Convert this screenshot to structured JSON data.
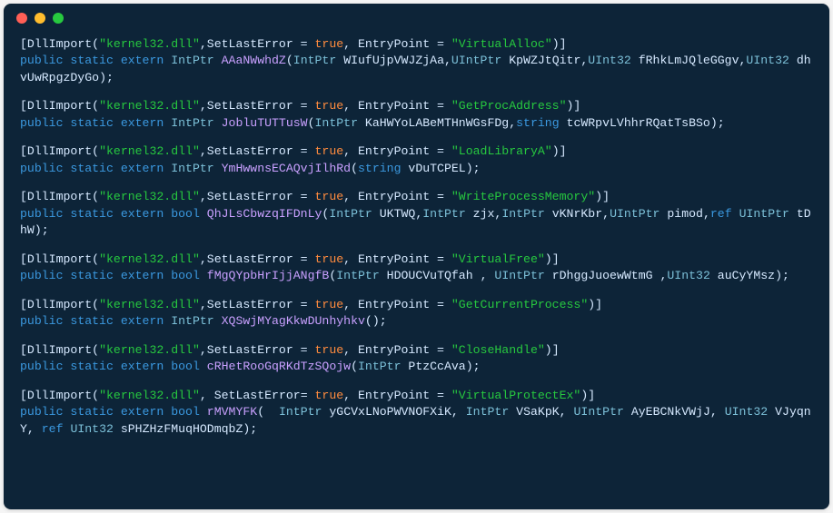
{
  "window": {
    "traffic_lights": [
      "red",
      "yellow",
      "green"
    ]
  },
  "colors": {
    "bg": "#0d2438",
    "string": "#27c93f",
    "keyword": "#3b99e0",
    "type": "#7cc0d8",
    "method": "#c9a0ff",
    "bool": "#ff8b3e",
    "text": "#d6e9ff"
  },
  "blocks": [
    {
      "dll": "kernel32.dll",
      "sle_spacing": "tight",
      "entry_point": "VirtualAlloc",
      "attr_trail": ")]",
      "ret_type": "IntPtr",
      "method": "AAaNWwhdZ",
      "params": [
        {
          "type": "IntPtr",
          "name": "WIufUjpVWJZjAa"
        },
        {
          "type": "UIntPtr",
          "name": "KpWZJtQitr"
        },
        {
          "type": "UInt32",
          "name": "fRhkLmJQleGGgv"
        },
        {
          "type": "UInt32",
          "name": "dhvUwRpgzDyGo"
        }
      ]
    },
    {
      "dll": "kernel32.dll",
      "sle_spacing": "tight",
      "entry_point": "GetProcAddress",
      "attr_trail": ")]",
      "ret_type": "IntPtr",
      "method": "JobluTUTTusW",
      "params": [
        {
          "type": "IntPtr",
          "name": "KaHWYoLABeMTHnWGsFDg"
        },
        {
          "type": "string",
          "name": "tcWRpvLVhhrRQatTsBSo"
        }
      ]
    },
    {
      "dll": "kernel32.dll",
      "sle_spacing": "tight",
      "entry_point": "LoadLibraryA",
      "attr_trail": ")]",
      "ret_type": "IntPtr",
      "method": "YmHwwnsECAQvjIlhRd",
      "params": [
        {
          "type": "string",
          "name": "vDuTCPEL"
        }
      ]
    },
    {
      "dll": "kernel32.dll",
      "sle_spacing": "tight",
      "entry_point": "WriteProcessMemory",
      "attr_trail": ")]",
      "ret_type": "bool",
      "method": "QhJLsCbwzqIFDnLy",
      "params": [
        {
          "type": "IntPtr",
          "name": "UKTWQ"
        },
        {
          "type": "IntPtr",
          "name": "zjx"
        },
        {
          "type": "IntPtr",
          "name": "vKNrKbr"
        },
        {
          "type": "UIntPtr",
          "name": "pimod"
        },
        {
          "ref": true,
          "type": "UIntPtr",
          "name": "tDhW"
        }
      ]
    },
    {
      "dll": "kernel32.dll",
      "sle_spacing": "tight",
      "entry_point": "VirtualFree",
      "attr_trail": ")]",
      "ret_type": "bool",
      "method": "fMgQYpbHrIjjANgfB",
      "params": [
        {
          "type": "IntPtr",
          "name": "HDOUCVuTQfah",
          "pad": " "
        },
        {
          "lead": " ",
          "type": "UIntPtr",
          "name": "rDhggJuoewWtmG",
          "pad": " "
        },
        {
          "type": "UInt32",
          "name": "auCyYMsz"
        }
      ]
    },
    {
      "dll": "kernel32.dll",
      "sle_spacing": "tight",
      "entry_point": "GetCurrentProcess",
      "attr_trail": ")]",
      "ret_type": "IntPtr",
      "method": "XQSwjMYagKkwDUnhyhkv",
      "params": []
    },
    {
      "dll": "kernel32.dll",
      "sle_spacing": "tight",
      "entry_point": "CloseHandle",
      "attr_trail": ")]",
      "ret_type": "bool",
      "method": "cRHetRooGqRKdTzSQojw",
      "params": [
        {
          "type": "IntPtr",
          "name": "PtzCcAva"
        }
      ]
    },
    {
      "dll": "kernel32.dll",
      "sle_spacing": "loose",
      "entry_point": "VirtualProtectEx",
      "attr_trail": ")]",
      "ret_type": "bool",
      "method": "rMVMYFK",
      "method_pad": " ",
      "params": [
        {
          "lead": " ",
          "type": "IntPtr",
          "name": "yGCVxLNoPWVNOFXiK"
        },
        {
          "lead": " ",
          "type": "IntPtr",
          "name": "VSaKpK"
        },
        {
          "lead": " ",
          "type": "UIntPtr",
          "name": "AyEBCNkVWjJ"
        },
        {
          "lead": " ",
          "type": "UInt32",
          "name": "VJyqnY"
        },
        {
          "lead": " ",
          "ref": true,
          "type": "UInt32",
          "name": "sPHZHzFMuqHODmqbZ"
        }
      ]
    }
  ]
}
